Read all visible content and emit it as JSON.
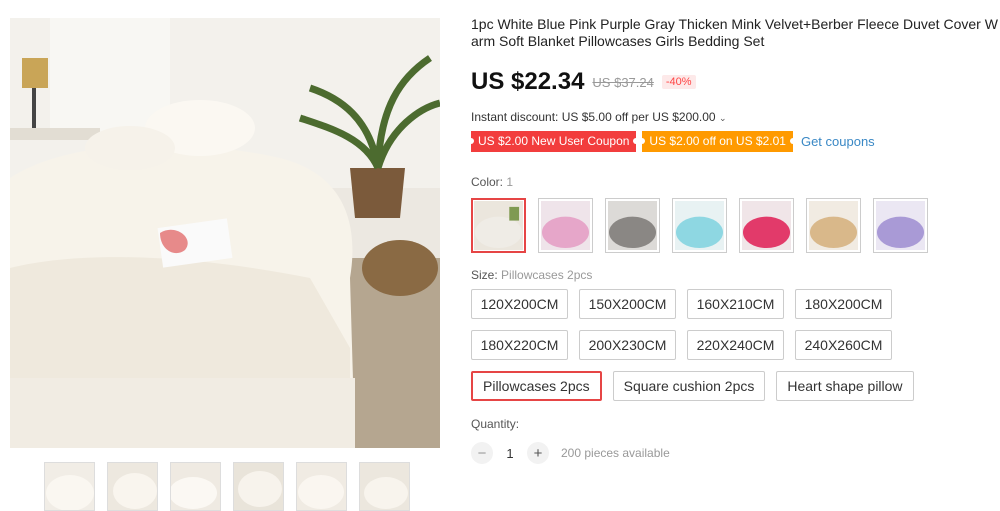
{
  "product": {
    "title": "1pc White Blue Pink Purple Gray Thicken Mink Velvet+Berber Fleece Duvet Cover Warm Soft Blanket Pillowcases Girls Bedding Set",
    "price": "US $22.34",
    "old_price": "US $37.24",
    "discount": "-40%"
  },
  "promo": {
    "instant_discount": "Instant discount: US $5.00 off per US $200.00",
    "coupons": [
      {
        "label": "US $2.00 New User Coupon",
        "color": "#f23d3d"
      },
      {
        "label": "US $2.00 off on US $2.01",
        "color": "#ff9a00"
      }
    ],
    "get_coupons": "Get coupons"
  },
  "color": {
    "label": "Color:",
    "value": "1",
    "swatches": [
      {
        "name": "white",
        "fill": "#efece6"
      },
      {
        "name": "pink",
        "fill": "#e6a6c9"
      },
      {
        "name": "gray",
        "fill": "#8a8784"
      },
      {
        "name": "blue",
        "fill": "#8ed7e2"
      },
      {
        "name": "rose",
        "fill": "#e23a6a"
      },
      {
        "name": "camel",
        "fill": "#d9b88a"
      },
      {
        "name": "purple",
        "fill": "#a99ad6"
      }
    ]
  },
  "size": {
    "label": "Size:",
    "value": "Pillowcases 2pcs",
    "options": [
      "120X200CM",
      "150X200CM",
      "160X210CM",
      "180X200CM",
      "180X220CM",
      "200X230CM",
      "220X240CM",
      "240X260CM",
      "Pillowcases 2pcs",
      "Square cushion 2pcs",
      "Heart shape pillow"
    ],
    "selected_index": 8
  },
  "quantity": {
    "label": "Quantity:",
    "minus": "−",
    "value": "1",
    "plus": "+",
    "available": "200 pieces available"
  },
  "icons": {
    "chevron": "chevron-down-icon"
  },
  "thumbnail_count": 6
}
